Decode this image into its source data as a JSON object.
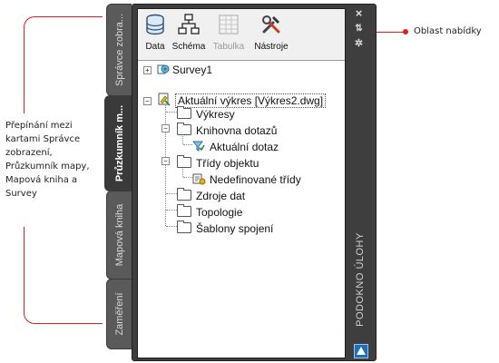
{
  "annotations": {
    "left_callout": "Přepínání mezi kartami Správce zobrazení, Průzkumník mapy, Mapová kniha a Survey",
    "right_callout": "Oblast nabídky"
  },
  "tabs": [
    {
      "label": "Správce zobra...",
      "active": false
    },
    {
      "label": "Průzkumník m...",
      "active": true
    },
    {
      "label": "Mapová kniha",
      "active": false
    },
    {
      "label": "Zaměření",
      "active": false
    }
  ],
  "ribbon": {
    "data_label": "Data",
    "schema_label": "Schéma",
    "table_label": "Tabulka",
    "tools_label": "Nástroje"
  },
  "tree": {
    "survey": "Survey1",
    "current_drawing": "Aktuální výkres [Výkres2.dwg]",
    "drawings": "Výkresy",
    "query_library": "Knihovna dotazů",
    "current_query": "Aktuální dotaz",
    "object_classes": "Třídy objektu",
    "undefined_classes": "Nedefinované třídy",
    "data_sources": "Zdroje dat",
    "topology": "Topologie",
    "link_templates": "Šablony spojení"
  },
  "side": {
    "task_pane": "PODOKNO ÚLOHY"
  },
  "colors": {
    "accent": "#e0201c",
    "frame": "#3e3e3e"
  }
}
